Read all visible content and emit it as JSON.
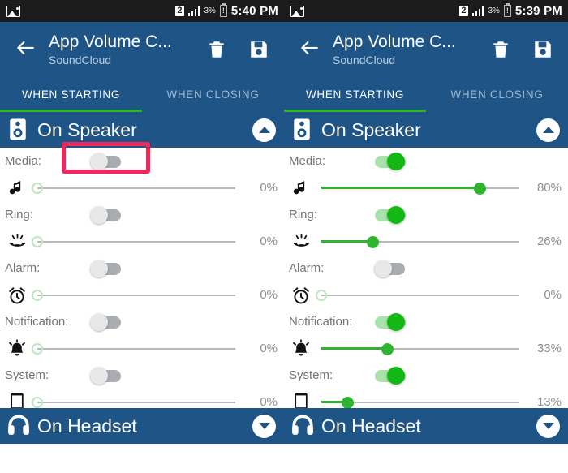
{
  "panels": [
    {
      "status": {
        "time": "5:40 PM",
        "battery_pct": "3%",
        "sim": "2",
        "photo_icon": "photo-icon",
        "signal_icon": "signal-icon",
        "battery_icon": "battery-alert-icon"
      },
      "appbar": {
        "title": "App Volume C...",
        "subtitle": "SoundCloud",
        "back_icon": "back-arrow-icon",
        "delete_icon": "trash-icon",
        "save_icon": "save-disk-icon"
      },
      "tabs": [
        {
          "label": "WHEN STARTING",
          "active": true
        },
        {
          "label": "WHEN CLOSING",
          "active": false
        }
      ],
      "section": {
        "title": "On Speaker",
        "icon": "speaker-icon",
        "chevron": "chevron-up-icon",
        "expanded": true
      },
      "rows": [
        {
          "label": "Media:",
          "icon": "music-note-icon",
          "enabled": false,
          "value": 0,
          "pct": "0%"
        },
        {
          "label": "Ring:",
          "icon": "ringtone-icon",
          "enabled": false,
          "value": 0,
          "pct": "0%"
        },
        {
          "label": "Alarm:",
          "icon": "alarm-clock-icon",
          "enabled": false,
          "value": 0,
          "pct": "0%"
        },
        {
          "label": "Notification:",
          "icon": "notification-bell-icon",
          "enabled": false,
          "value": 0,
          "pct": "0%"
        },
        {
          "label": "System:",
          "icon": "phone-icon",
          "enabled": false,
          "value": 0,
          "pct": "0%"
        }
      ],
      "bottom_section": {
        "title": "On Headset",
        "icon": "headset-icon",
        "chevron": "chevron-down-icon",
        "expanded": false
      },
      "highlight": {
        "present": true,
        "target": "media-toggle",
        "color": "#ec2a5e"
      }
    },
    {
      "status": {
        "time": "5:39 PM",
        "battery_pct": "3%",
        "sim": "2",
        "photo_icon": "photo-icon",
        "signal_icon": "signal-icon",
        "battery_icon": "battery-alert-icon"
      },
      "appbar": {
        "title": "App Volume C...",
        "subtitle": "SoundCloud",
        "back_icon": "back-arrow-icon",
        "delete_icon": "trash-icon",
        "save_icon": "save-disk-icon"
      },
      "tabs": [
        {
          "label": "WHEN STARTING",
          "active": true
        },
        {
          "label": "WHEN CLOSING",
          "active": false
        }
      ],
      "section": {
        "title": "On Speaker",
        "icon": "speaker-icon",
        "chevron": "chevron-up-icon",
        "expanded": true
      },
      "rows": [
        {
          "label": "Media:",
          "icon": "music-note-icon",
          "enabled": true,
          "value": 80,
          "pct": "80%"
        },
        {
          "label": "Ring:",
          "icon": "ringtone-icon",
          "enabled": true,
          "value": 26,
          "pct": "26%"
        },
        {
          "label": "Alarm:",
          "icon": "alarm-clock-icon",
          "enabled": false,
          "value": 0,
          "pct": "0%"
        },
        {
          "label": "Notification:",
          "icon": "notification-bell-icon",
          "enabled": true,
          "value": 33,
          "pct": "33%"
        },
        {
          "label": "System:",
          "icon": "phone-icon",
          "enabled": true,
          "value": 13,
          "pct": "13%"
        }
      ],
      "bottom_section": {
        "title": "On Headset",
        "icon": "headset-icon",
        "chevron": "chevron-down-icon",
        "expanded": false
      },
      "highlight": {
        "present": false
      }
    }
  ],
  "colors": {
    "app_bar_blue": "#1f5486",
    "status_bar": "#1b1b1b",
    "accent_green": "#2fb42f",
    "toggle_on": "#14b814",
    "toggle_off": "#a9adb2",
    "highlight_pink": "#ec2a5e",
    "label_grey": "#70757a"
  }
}
